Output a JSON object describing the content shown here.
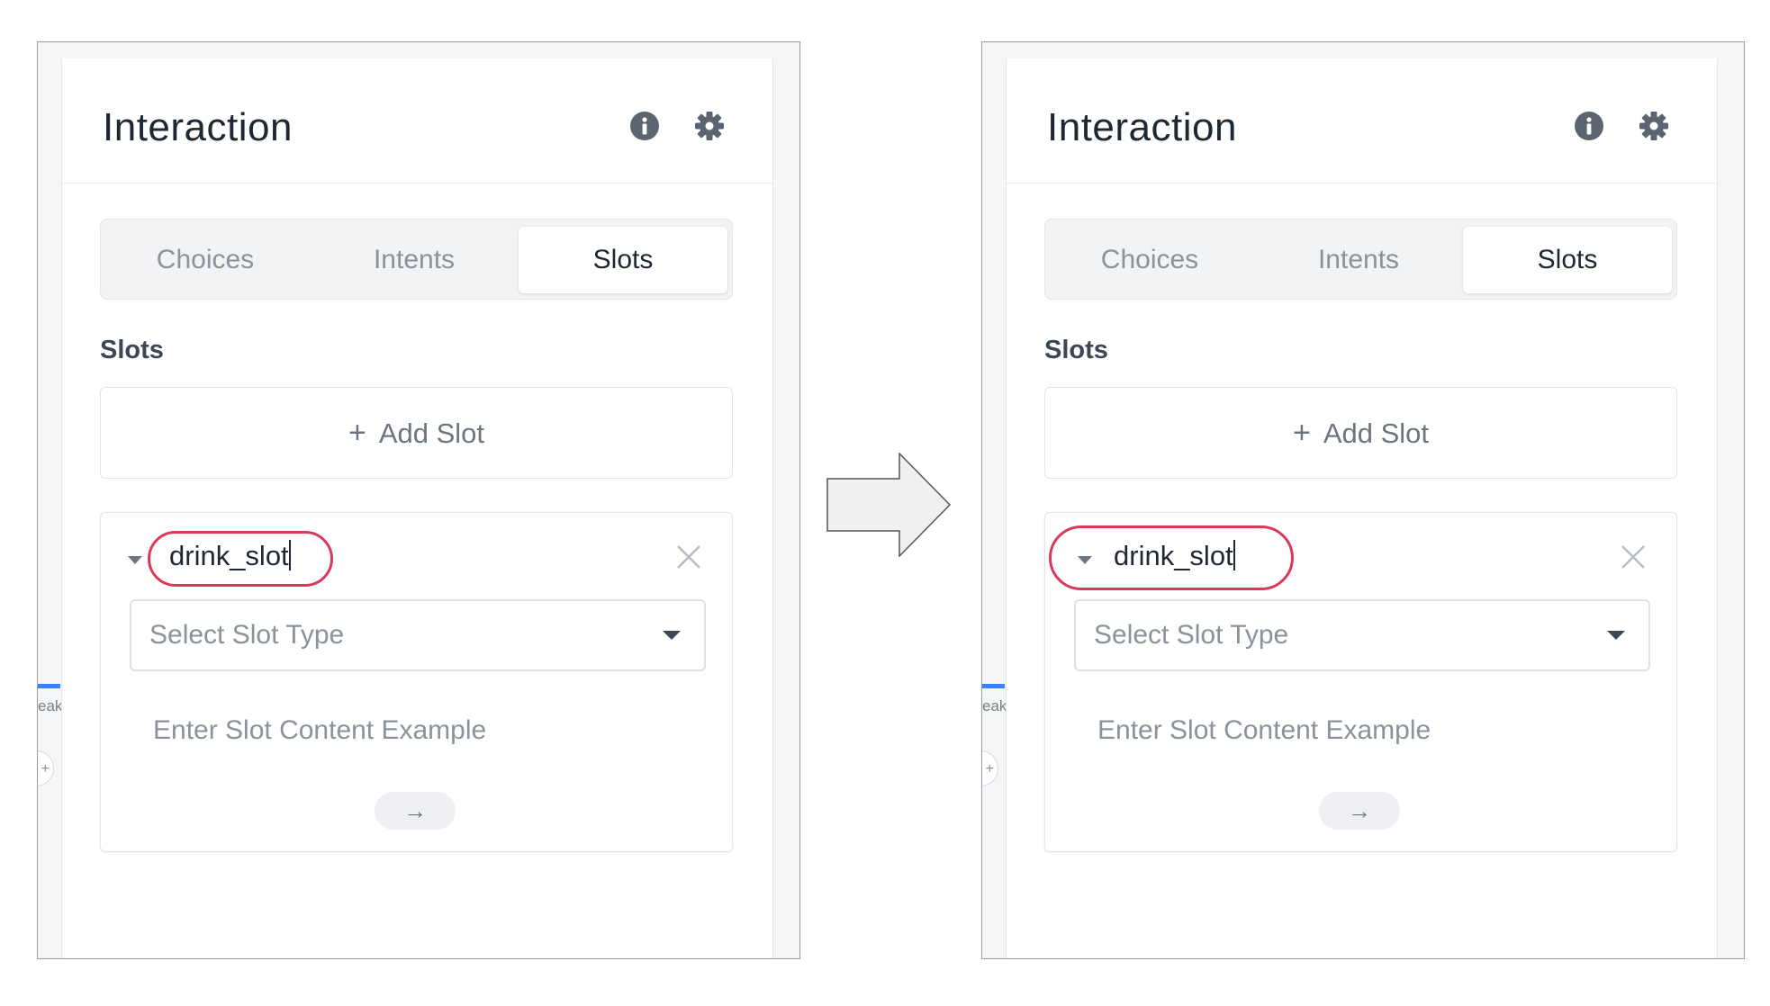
{
  "panels": [
    {
      "title": "Interaction",
      "edge_text": "eak",
      "edge_circle": "+",
      "tabs": [
        "Choices",
        "Intents",
        "Slots"
      ],
      "active_tab": "Slots",
      "section_label": "Slots",
      "add_slot": {
        "icon": "+",
        "label": "Add Slot"
      },
      "slot": {
        "name": "drink_slot",
        "select_placeholder": "Select Slot Type",
        "example_placeholder": "Enter Slot Content Example",
        "submit_icon": "→"
      }
    },
    {
      "title": "Interaction",
      "edge_text": "eak",
      "edge_circle": "+",
      "tabs": [
        "Choices",
        "Intents",
        "Slots"
      ],
      "active_tab": "Slots",
      "section_label": "Slots",
      "add_slot": {
        "icon": "+",
        "label": "Add Slot"
      },
      "slot": {
        "name": "drink_slot",
        "select_placeholder": "Select Slot Type",
        "example_placeholder": "Enter Slot Content Example",
        "submit_icon": "→"
      }
    }
  ],
  "colors": {
    "highlight": "#d93a5a",
    "accent": "#3b82f6",
    "text_dark": "#1f2733",
    "text_muted": "#8a929c"
  },
  "icons": {
    "info": "info-icon",
    "settings": "gear-icon",
    "close": "close-icon",
    "collapse": "caret-down-icon",
    "transition": "right-arrow-icon"
  }
}
